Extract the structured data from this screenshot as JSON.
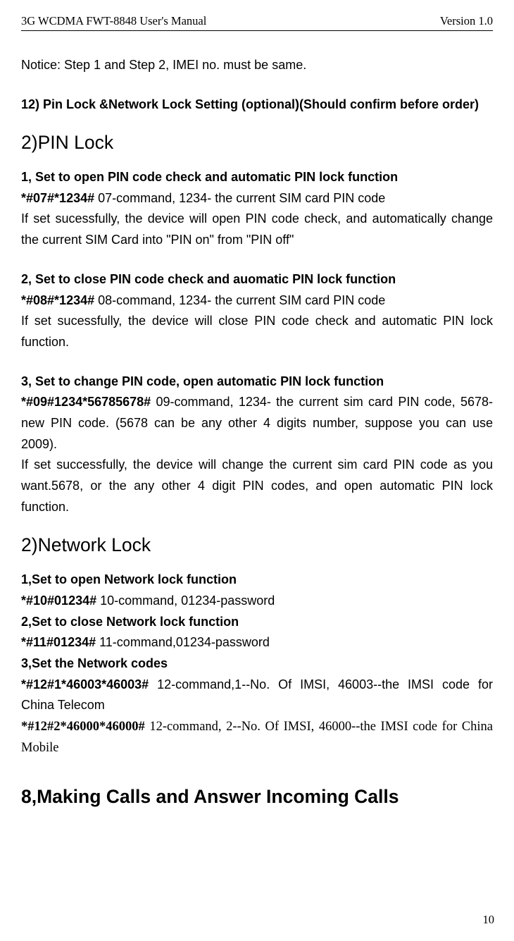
{
  "header": {
    "left": "3G WCDMA FWT-8848 User's Manual",
    "right": "Version 1.0"
  },
  "notice": "Notice: Step 1 and Step 2, IMEI no. must be same.",
  "section12title": "12) Pin Lock &Network Lock Setting (optional)(Should confirm before order)",
  "pinlock": {
    "heading": "2)PIN Lock",
    "s1": {
      "title": "1, Set to open PIN code check and automatic PIN lock function",
      "cmd": "*#07#*1234#",
      "cmdrest": "    07-command, 1234- the current SIM card PIN code",
      "desc": "If set sucessfully, the device will open PIN code check, and automatically change the current SIM Card into \"PIN on\" from \"PIN off\""
    },
    "s2": {
      "title": "2, Set to close PIN code check and auomatic PIN lock function",
      "cmd": "*#08#*1234#",
      "cmdrest": "    08-command, 1234- the current SIM card PIN code",
      "desc": "If set sucessfully, the device will close PIN code check and automatic PIN lock function."
    },
    "s3": {
      "title": "3, Set to change PIN code, open automatic PIN lock function",
      "cmd": "*#09#1234*56785678#",
      "cmdrest": " 09-command, 1234- the current sim card PIN code, 5678-new PIN code. (5678 can be any other 4 digits number, suppose you can use 2009).",
      "desc": "If set successfully, the device will change the current sim card PIN code as you want.5678, or the any other 4 digit PIN codes, and open automatic PIN lock function."
    }
  },
  "netlock": {
    "heading": "2)Network Lock",
    "s1": {
      "title": "1,Set to open Network lock function",
      "cmd": "*#10#01234#",
      "cmdrest": " 10-command, 01234-password"
    },
    "s2": {
      "title": "2,Set to close Network lock function",
      "cmd": "*#11#01234#",
      "cmdrest": " 11-command,01234-password"
    },
    "s3": {
      "title": "3,Set the Network codes",
      "cmd": "*#12#1*46003*46003#",
      "cmdrest": " 12-command,1--No. Of IMSI, 46003--the IMSI code for China Telecom"
    },
    "s4": {
      "cmd": "*#12#2*46000*46000#",
      "cmdrest": " 12-command, 2--No. Of IMSI, 46000--the IMSI code for China Mobile"
    }
  },
  "section8": "8,Making Calls and Answer Incoming Calls",
  "page": "10"
}
